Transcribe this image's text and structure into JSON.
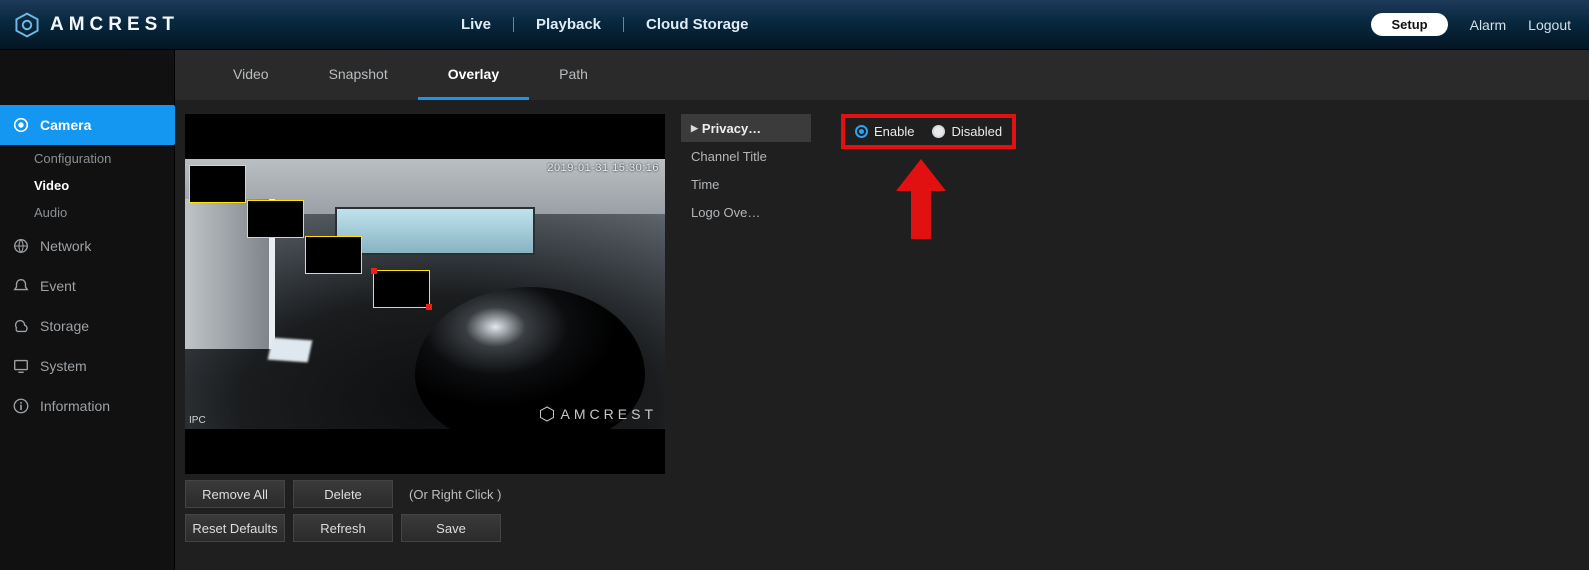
{
  "brand": {
    "name": "AMCREST"
  },
  "topnav": {
    "live": "Live",
    "playback": "Playback",
    "cloud": "Cloud Storage"
  },
  "topright": {
    "setup": "Setup",
    "alarm": "Alarm",
    "logout": "Logout"
  },
  "sidebar": {
    "camera": "Camera",
    "camera_subs": {
      "configuration": "Configuration",
      "video": "Video",
      "audio": "Audio"
    },
    "network": "Network",
    "event": "Event",
    "storage": "Storage",
    "system": "System",
    "information": "Information"
  },
  "subtabs": {
    "video": "Video",
    "snapshot": "Snapshot",
    "overlay": "Overlay",
    "path": "Path"
  },
  "preview": {
    "timestamp": "2019-01-31 15:30:16",
    "ipc": "IPC",
    "watermark": "AMCREST"
  },
  "buttons": {
    "remove_all": "Remove All",
    "delete": "Delete",
    "hint": "(Or Right Click )",
    "reset": "Reset Defaults",
    "refresh": "Refresh",
    "save": "Save"
  },
  "overlay_list": {
    "privacy": "Privacy…",
    "channel": "Channel Title",
    "time": "Time",
    "logo": "Logo Ove…"
  },
  "radio": {
    "enable": "Enable",
    "disabled": "Disabled"
  }
}
